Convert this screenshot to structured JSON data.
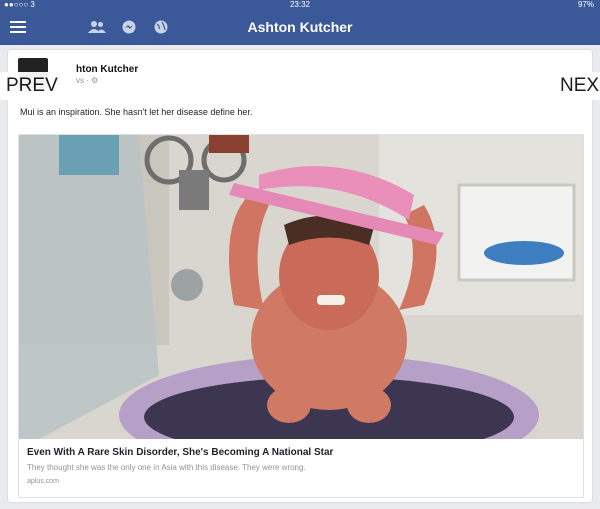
{
  "statusbar": {
    "carrier": "●●○○○ 3",
    "time": "23:32",
    "battery": "97%"
  },
  "navbar": {
    "title": "Ashton Kutcher",
    "icons": [
      "menu-icon",
      "friends-icon",
      "messages-icon",
      "globe-icon"
    ]
  },
  "post": {
    "author": "hton Kutcher",
    "meta": "vs · ⚙",
    "text": "Mui is an inspiration. She hasn't let her disease define her.",
    "link": {
      "title": "Even With A Rare Skin Disorder, She's Becoming A National Star",
      "description": "They thought she was the only one in Asia with this disease. They were wrong.",
      "domain": "aplus.com"
    }
  },
  "overlay": {
    "prev": "PREV",
    "next": "NEX"
  }
}
